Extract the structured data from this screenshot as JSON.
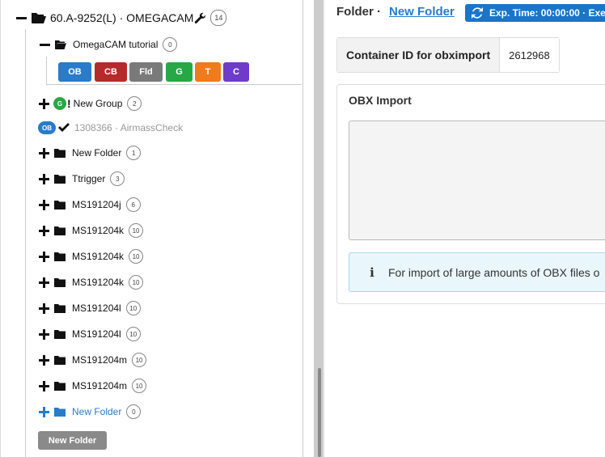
{
  "tree": {
    "root": {
      "label": "60.A-9252(L) · OMEGACAM",
      "count": "14"
    },
    "tutorial": {
      "label": "OmegaCAM tutorial",
      "count": "0",
      "toolbar": [
        {
          "label": "OB",
          "color": "#2a7bc8"
        },
        {
          "label": "CB",
          "color": "#b52a2a"
        },
        {
          "label": "Fld",
          "color": "#7a7a7a"
        },
        {
          "label": "G",
          "color": "#28a745"
        },
        {
          "label": "T",
          "color": "#f07a1c"
        },
        {
          "label": "C",
          "color": "#6f3bc9"
        }
      ]
    },
    "group": {
      "badge": "G",
      "label": "New Group",
      "count": "2"
    },
    "ob": {
      "badge": "OB",
      "label": "1308366 · AirmassCheck"
    },
    "folders": [
      {
        "label": "New Folder",
        "count": "1"
      },
      {
        "label": "Ttrigger",
        "count": "3"
      },
      {
        "label": "MS191204j",
        "count": "6"
      },
      {
        "label": "MS191204k",
        "count": "10"
      },
      {
        "label": "MS191204k",
        "count": "10"
      },
      {
        "label": "MS191204k",
        "count": "10"
      },
      {
        "label": "MS191204l",
        "count": "10"
      },
      {
        "label": "MS191204l",
        "count": "10"
      },
      {
        "label": "MS191204m",
        "count": "10"
      },
      {
        "label": "MS191204m",
        "count": "10"
      }
    ],
    "selected_folder": {
      "label": "New Folder",
      "count": "0"
    },
    "new_folder_button": "New Folder"
  },
  "detail": {
    "title": "Folder ·",
    "title_link": "New Folder",
    "exp_time": "Exp. Time: 00:00:00 · Exe",
    "container_id_label": "Container ID for obximport",
    "container_id_value": "2612968",
    "card_title": "OBX Import",
    "info_text": "For import of large amounts of OBX files o"
  }
}
